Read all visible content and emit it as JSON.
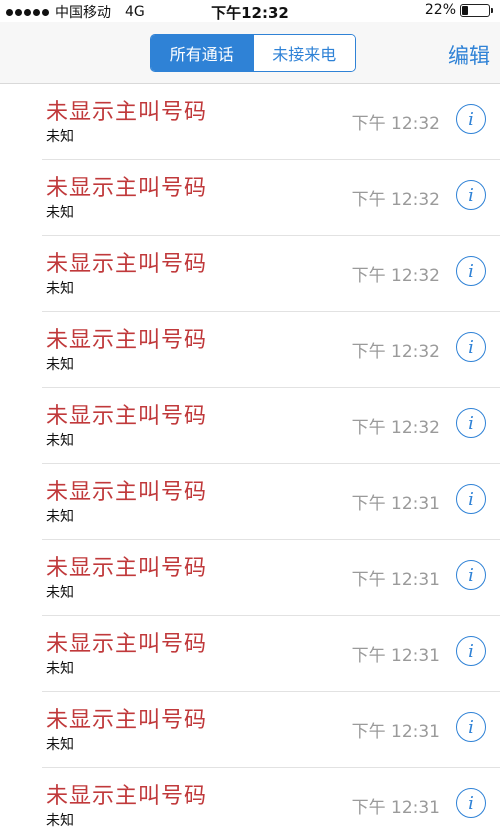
{
  "status_bar": {
    "carrier": "中国移动",
    "network": "4G",
    "time": "下午12:32",
    "battery_text": "22%",
    "battery_level": 0.22
  },
  "nav": {
    "tabs": [
      {
        "label": "所有通话",
        "active": true
      },
      {
        "label": "未接来电",
        "active": false
      }
    ],
    "edit_label": "编辑"
  },
  "calls": [
    {
      "caller": "未显示主叫号码",
      "type": "未知",
      "time": "下午 12:32"
    },
    {
      "caller": "未显示主叫号码",
      "type": "未知",
      "time": "下午 12:32"
    },
    {
      "caller": "未显示主叫号码",
      "type": "未知",
      "time": "下午 12:32"
    },
    {
      "caller": "未显示主叫号码",
      "type": "未知",
      "time": "下午 12:32"
    },
    {
      "caller": "未显示主叫号码",
      "type": "未知",
      "time": "下午 12:32"
    },
    {
      "caller": "未显示主叫号码",
      "type": "未知",
      "time": "下午 12:31"
    },
    {
      "caller": "未显示主叫号码",
      "type": "未知",
      "time": "下午 12:31"
    },
    {
      "caller": "未显示主叫号码",
      "type": "未知",
      "time": "下午 12:31"
    },
    {
      "caller": "未显示主叫号码",
      "type": "未知",
      "time": "下午 12:31"
    },
    {
      "caller": "未显示主叫号码",
      "type": "未知",
      "time": "下午 12:31"
    }
  ],
  "icons": {
    "info": "info-icon"
  },
  "colors": {
    "accent": "#2f82d6",
    "missed_call": "#c0393b",
    "time_gray": "#9a9a9a"
  }
}
